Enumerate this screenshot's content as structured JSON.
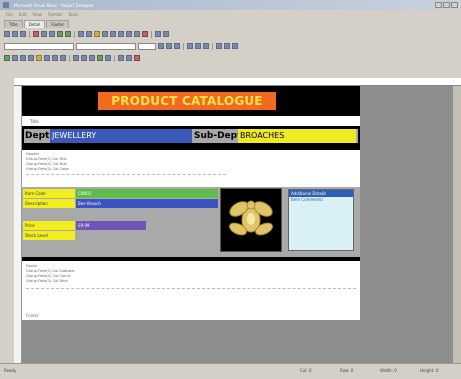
{
  "window": {
    "title": "Microsoft Visual Basic - Report Designer"
  },
  "menu": [
    "File",
    "Edit",
    "View",
    "Format",
    "Tools"
  ],
  "tabs": [
    {
      "label": "Title"
    },
    {
      "label": "Detail",
      "active": true
    },
    {
      "label": "Footer"
    }
  ],
  "report": {
    "title": "PRODUCT CATALOGUE",
    "top_label": "Title",
    "dept_label": "Dept:",
    "dept_value": "JEWELLERY",
    "subdept_label": "Sub-Dept:",
    "subdept_value": "BROACHES",
    "group_lines": [
      "Header",
      "Group.Field(1)  Col.Text",
      "Group.Field(2)  Col.Text",
      "Group.Field(3)  Col.Code"
    ],
    "detail": {
      "labels": [
        "Item Code",
        "Description",
        "Price",
        "Stock Level"
      ],
      "values": [
        "CN001",
        "Bee Brooch",
        "£9.99",
        ""
      ],
      "additional_header": "Additional Details",
      "additional_line": "Item Comments"
    },
    "group_footer_lines": [
      "Footer",
      "Group.Field(1)  Col.Subtotal",
      "Group.Field(2)  Col.Count",
      "Group.Field(3)  Col.Total"
    ],
    "page_footer": "Footer"
  },
  "status": {
    "left": "Ready",
    "pos1": "Col: 0",
    "pos2": "Row: 0",
    "pos3": "Width: 0",
    "pos4": "Height: 0"
  },
  "colors": {
    "title_bg": "#f26a1f",
    "title_text": "#fde34a",
    "dept_blue": "#3a58b6",
    "subdept_yellow": "#f0ea22",
    "field_green": "#5fbc4a",
    "label_yellow": "#f2ee1f",
    "details_cyan": "#d9f1f4"
  }
}
